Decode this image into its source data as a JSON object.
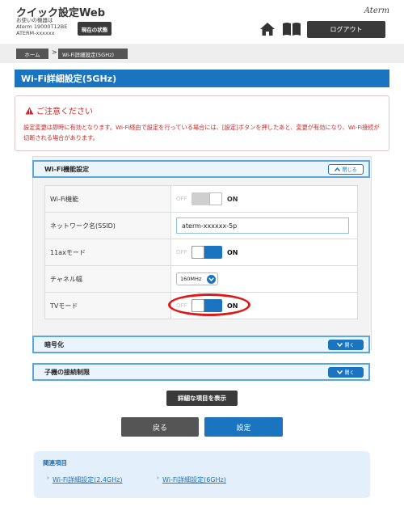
{
  "header": {
    "title": "クイック設定Web",
    "device_line1": "お使いの機器は",
    "device_line2": "Aterm 19000T12BE",
    "device_line3": "ATERM-xxxxxx",
    "status_button": "現在の状態",
    "brand": "Aterm",
    "logout_button": "ログアウト"
  },
  "breadcrumb": {
    "home": "ホーム",
    "separator": ">",
    "current": "Wi-Fi詳細設定(5GHz)"
  },
  "page_title": "Wi-Fi詳細設定(5GHz)",
  "caution": {
    "title": "ご注意ください",
    "text": "設定変更は即時に有効となります。Wi-Fi経由で設定を行っている場合には、[設定]ボタンを押したあと、変更が有効になり、Wi-Fi接続が切断される場合があります。"
  },
  "wifi_section": {
    "title": "Wi-Fi機能設定",
    "toggle_button": "閉じる",
    "rows": [
      {
        "label": "Wi-Fi機能",
        "type": "toggle",
        "off": "OFF",
        "on": "ON",
        "state": "disabled-on"
      },
      {
        "label": "ネットワーク名(SSID)",
        "type": "input",
        "value": "aterm-xxxxxx-5p"
      },
      {
        "label": "11axモード",
        "type": "toggle",
        "off": "OFF",
        "on": "ON",
        "state": "on"
      },
      {
        "label": "チャネル幅",
        "type": "select",
        "value": "160MHz"
      },
      {
        "label": "TVモード",
        "type": "toggle",
        "off": "OFF",
        "on": "ON",
        "state": "on"
      }
    ]
  },
  "encryption_section": {
    "title": "暗号化",
    "toggle_button": "開く"
  },
  "client_limit_section": {
    "title": "子機の接続制限",
    "toggle_button": "開く"
  },
  "buttons": {
    "detail": "詳細な項目を表示",
    "back": "戻る",
    "apply": "設定"
  },
  "related": {
    "title": "関連項目",
    "links": [
      "Wi-Fi詳細設定(2.4GHz)",
      "Wi-Fi詳細設定(6GHz)"
    ]
  },
  "colors": {
    "accent": "#1a74bf",
    "caution_text": "#c62828",
    "highlight": "#e01818",
    "dark_button": "#3a3a3a"
  }
}
